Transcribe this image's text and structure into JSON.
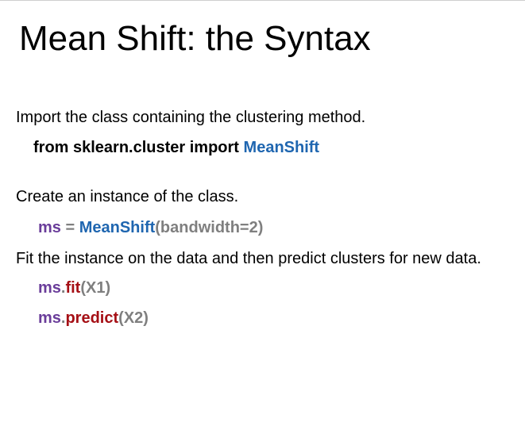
{
  "title": "Mean Shift: the Syntax",
  "steps": [
    {
      "text": "Import the class containing the clustering method.",
      "code": [
        {
          "text": "from sklearn.cluster import ",
          "color": "#000000"
        },
        {
          "text": "MeanShift",
          "color": "#1f66b0"
        }
      ]
    },
    {
      "text": "Create an instance of the class.",
      "code": [
        {
          "text": "ms",
          "color": "#6a3d9a"
        },
        {
          "text": " = ",
          "color": "#7f7f7f"
        },
        {
          "text": "MeanShift",
          "color": "#1f66b0"
        },
        {
          "text": "(bandwidth=2)",
          "color": "#7f7f7f"
        }
      ]
    },
    {
      "text": "Fit the instance on the data and then predict clusters for new data.",
      "code_lines": [
        [
          {
            "text": "ms",
            "color": "#6a3d9a"
          },
          {
            "text": ".",
            "color": "#7f7f7f"
          },
          {
            "text": "fit",
            "color": "#a50f15"
          },
          {
            "text": "(X1)",
            "color": "#7f7f7f"
          }
        ],
        [
          {
            "text": "ms",
            "color": "#6a3d9a"
          },
          {
            "text": ".",
            "color": "#7f7f7f"
          },
          {
            "text": "predict",
            "color": "#a50f15"
          },
          {
            "text": "(X2)",
            "color": "#7f7f7f"
          }
        ]
      ]
    }
  ]
}
